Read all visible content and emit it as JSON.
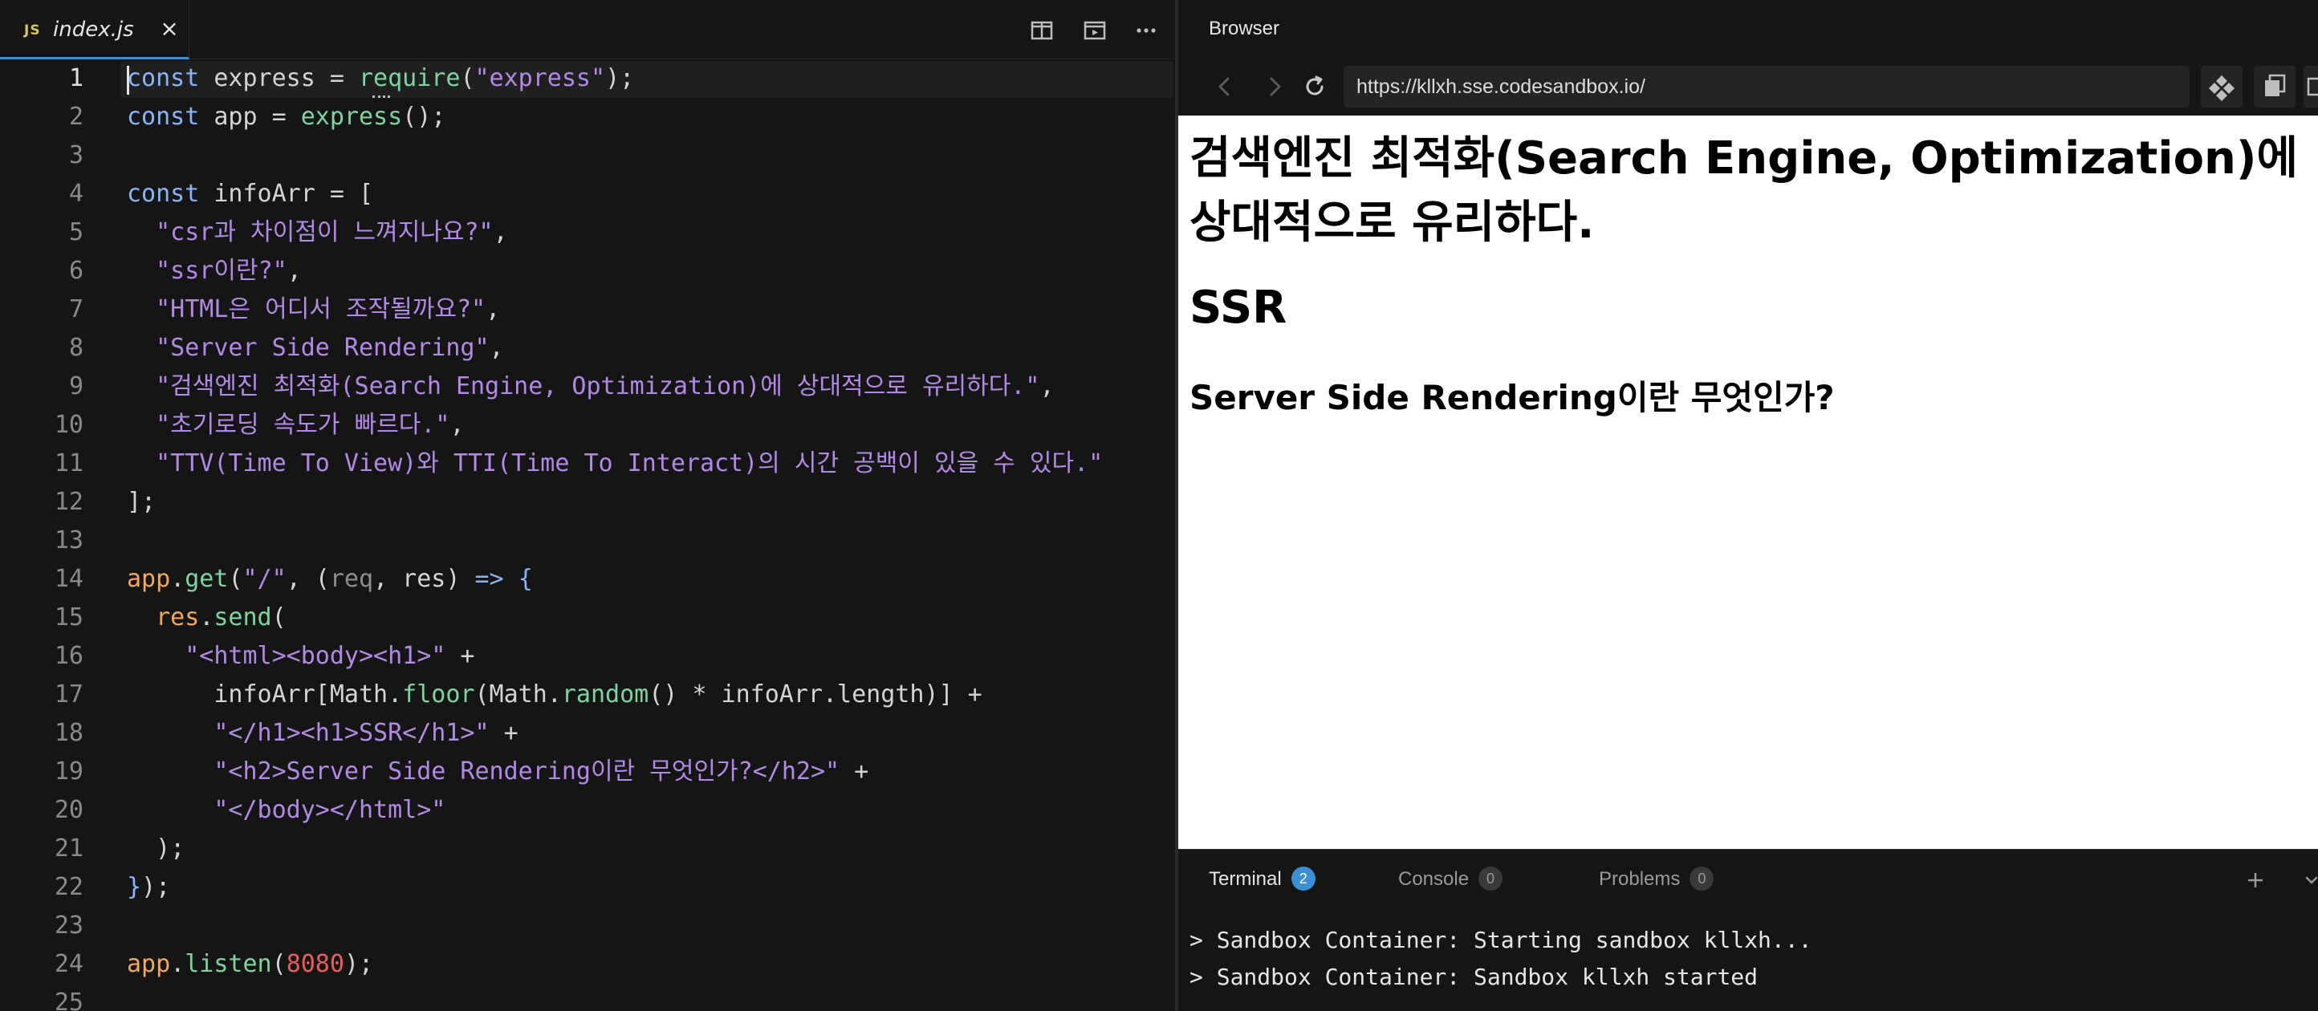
{
  "editor": {
    "tab": {
      "badge": "JS",
      "filename": "index.js",
      "close": "×"
    },
    "lines": [
      {
        "num": "1",
        "tokens": [
          [
            "k",
            "const"
          ],
          [
            "w",
            " express = "
          ],
          [
            "f",
            "require"
          ],
          [
            "w",
            "("
          ],
          [
            "s",
            "\"express\""
          ],
          [
            "w",
            ");"
          ]
        ]
      },
      {
        "num": "2",
        "tokens": [
          [
            "k",
            "const"
          ],
          [
            "w",
            " app = "
          ],
          [
            "f",
            "express"
          ],
          [
            "w",
            "();"
          ]
        ]
      },
      {
        "num": "3",
        "tokens": []
      },
      {
        "num": "4",
        "tokens": [
          [
            "k",
            "const"
          ],
          [
            "w",
            " infoArr = ["
          ]
        ]
      },
      {
        "num": "5",
        "tokens": [
          [
            "s",
            "  \"csr과 차이점이 느껴지나요?\""
          ],
          [
            "w",
            ","
          ]
        ]
      },
      {
        "num": "6",
        "tokens": [
          [
            "s",
            "  \"ssr이란?\""
          ],
          [
            "w",
            ","
          ]
        ]
      },
      {
        "num": "7",
        "tokens": [
          [
            "s",
            "  \"HTML은 어디서 조작될까요?\""
          ],
          [
            "w",
            ","
          ]
        ]
      },
      {
        "num": "8",
        "tokens": [
          [
            "s",
            "  \"Server Side Rendering\""
          ],
          [
            "w",
            ","
          ]
        ]
      },
      {
        "num": "9",
        "tokens": [
          [
            "s",
            "  \"검색엔진 최적화(Search Engine, Optimization)에 상대적으로 유리하다.\""
          ],
          [
            "w",
            ","
          ]
        ]
      },
      {
        "num": "10",
        "tokens": [
          [
            "s",
            "  \"초기로딩 속도가 빠르다.\""
          ],
          [
            "w",
            ","
          ]
        ]
      },
      {
        "num": "11",
        "tokens": [
          [
            "s",
            "  \"TTV(Time To View)와 TTI(Time To Interact)의 시간 공백이 있을 수 있다.\""
          ]
        ]
      },
      {
        "num": "12",
        "tokens": [
          [
            "w",
            "];"
          ]
        ]
      },
      {
        "num": "13",
        "tokens": []
      },
      {
        "num": "14",
        "tokens": [
          [
            "v",
            "app"
          ],
          [
            "w",
            "."
          ],
          [
            "f",
            "get"
          ],
          [
            "w",
            "("
          ],
          [
            "s",
            "\"/\""
          ],
          [
            "w",
            ", ("
          ],
          [
            "pn",
            "req"
          ],
          [
            "w",
            ", res) "
          ],
          [
            "k",
            "=>"
          ],
          [
            "w",
            " "
          ],
          [
            "k",
            "{"
          ]
        ]
      },
      {
        "num": "15",
        "tokens": [
          [
            "w",
            "  "
          ],
          [
            "v",
            "res"
          ],
          [
            "w",
            "."
          ],
          [
            "f",
            "send"
          ],
          [
            "w",
            "("
          ]
        ]
      },
      {
        "num": "16",
        "tokens": [
          [
            "w",
            "    "
          ],
          [
            "s",
            "\"<html><body><h1>\""
          ],
          [
            "w",
            " +"
          ]
        ]
      },
      {
        "num": "17",
        "tokens": [
          [
            "w",
            "      infoArr[Math."
          ],
          [
            "f",
            "floor"
          ],
          [
            "w",
            "(Math."
          ],
          [
            "f",
            "random"
          ],
          [
            "w",
            "() * infoArr.length)] +"
          ]
        ]
      },
      {
        "num": "18",
        "tokens": [
          [
            "w",
            "      "
          ],
          [
            "s",
            "\"</h1><h1>SSR</h1>\""
          ],
          [
            "w",
            " +"
          ]
        ]
      },
      {
        "num": "19",
        "tokens": [
          [
            "w",
            "      "
          ],
          [
            "s",
            "\"<h2>Server Side Rendering이란 무엇인가?</h2>\""
          ],
          [
            "w",
            " +"
          ]
        ]
      },
      {
        "num": "20",
        "tokens": [
          [
            "w",
            "      "
          ],
          [
            "s",
            "\"</body></html>\""
          ]
        ]
      },
      {
        "num": "21",
        "tokens": [
          [
            "w",
            "  );"
          ]
        ]
      },
      {
        "num": "22",
        "tokens": [
          [
            "k",
            "}"
          ],
          [
            "w",
            ");"
          ]
        ]
      },
      {
        "num": "23",
        "tokens": []
      },
      {
        "num": "24",
        "tokens": [
          [
            "v",
            "app"
          ],
          [
            "w",
            "."
          ],
          [
            "f",
            "listen"
          ],
          [
            "w",
            "("
          ],
          [
            "n",
            "8080"
          ],
          [
            "w",
            ");"
          ]
        ]
      },
      {
        "num": "25",
        "tokens": []
      }
    ]
  },
  "browser": {
    "title": "Browser",
    "url": "https://kllxh.sse.codesandbox.io/",
    "page": {
      "h1": "검색엔진 최적화(Search Engine, Optimization)에 상대적으로 유리하다.",
      "h1_ssr": "SSR",
      "h2": "Server Side Rendering이란 무엇인가?"
    }
  },
  "panel": {
    "tabs": [
      {
        "label": "Terminal",
        "count": "2"
      },
      {
        "label": "Console",
        "count": "0"
      },
      {
        "label": "Problems",
        "count": "0"
      }
    ],
    "terminal_lines": [
      "> Sandbox Container: Starting sandbox kllxh...",
      "> Sandbox Container: Sandbox kllxh started"
    ]
  },
  "colors": {
    "keyword": "#8ab4f8",
    "string": "#b28ae6",
    "function": "#7fd3a0",
    "variable": "#f1a85b",
    "number": "#e85d5d",
    "accent": "#3b8fd6"
  },
  "icons": [
    "split-editor-icon",
    "preview-icon",
    "more-icon",
    "back-icon",
    "forward-icon",
    "refresh-icon",
    "codesandbox-icon",
    "copy-icon",
    "add-icon",
    "chevron-down-icon"
  ]
}
